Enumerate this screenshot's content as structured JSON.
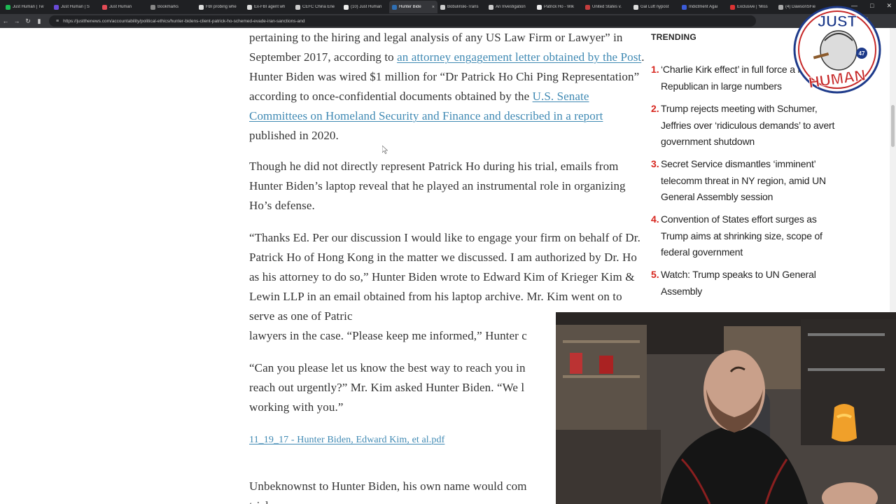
{
  "browser": {
    "tabs": [
      {
        "label": "Just Human | Tw",
        "color": "#1db954"
      },
      {
        "label": "Just Human | S",
        "color": "#6a4bd8"
      },
      {
        "label": "Just Human",
        "color": "#e34b55"
      },
      {
        "label": "Bookmarks",
        "color": "#888888"
      },
      {
        "label": "FBI probing whe",
        "color": "#dddddd"
      },
      {
        "label": "Ex-FBI agent wh",
        "color": "#dddddd"
      },
      {
        "label": "CEFC China Ene",
        "color": "#cccccc"
      },
      {
        "label": "(10) Just Human",
        "color": "#eeeeee"
      },
      {
        "label": "Hunter Bide",
        "color": "#2f6fb3"
      },
      {
        "label": "Bobulinski-Trans",
        "color": "#cccccc"
      },
      {
        "label": "An Investigation",
        "color": "#cccccc"
      },
      {
        "label": "Patrick Ho - Wik",
        "color": "#eeeeee"
      },
      {
        "label": "United States v.",
        "color": "#c43d3d"
      },
      {
        "label": "Gal Luft nypost",
        "color": "#dddddd"
      },
      {
        "label": "Indictment Agai",
        "color": "#3b5bd8"
      },
      {
        "label": "Exclusive | 'Miss",
        "color": "#d33"
      },
      {
        "label": "(4) DawsonSFie",
        "color": "#aaaaaa"
      }
    ],
    "active_tab_index": 8,
    "url": "https://justthenews.com/accountability/political-ethics/hunter-bidens-client-patrick-ho-schemed-evade-iran-sanctions-and"
  },
  "article": {
    "p1": {
      "t1": "pertaining to the hiring and legal analysis of any US Law Firm or Lawyer” in September 2017, according to ",
      "link1": "an attorney engagement letter obtained by the Post",
      "t2": ". Hunter Biden was wired $1 million for “Dr Patrick Ho Chi Ping Representation” according to once-confidential documents obtained by the ",
      "link2": "U.S. Senate Committees on Homeland Security and Finance and described in a report",
      "t3": " published in 2020."
    },
    "p2": "Though he did not directly represent Patrick Ho during his trial, emails from Hunter Biden’s laptop reveal that he played an instrumental role in organizing Ho’s defense.",
    "p3": "“Thanks Ed. Per our discussion I would like to engage your firm on behalf of Dr. Patrick Ho of Hong Kong in the matter we discussed. I am authorized by Dr. Ho as his attorney to do so,” Hunter Biden wrote to Edward Kim of Krieger Kim & Lewin LLP in an email obtained from his laptop archive. Mr. Kim went on to serve as one of Patric",
    "p3_tail": "lawyers in the case. “Please keep me informed,” Hunter c",
    "p4": "“Can you please let us know the best way to reach you in reach out urgently?” Mr. Kim asked Hunter Biden. “We l working with you.”",
    "p4_lines": [
      "“Can you please let us know the best way to reach you in",
      "reach out urgently?” Mr. Kim asked Hunter Biden. “We l",
      "working with you.”"
    ],
    "pdf_link": "11_19_17 - Hunter Biden, Edward Kim, et al.pdf",
    "p5_lines": [
      "Unbeknownst to Hunter Biden, his own name would com",
      "trial"
    ]
  },
  "trending": {
    "title": "TRENDING",
    "items": [
      {
        "num": "1.",
        "text": "‘Charlie Kirk effect’ in full force a register Republican in large numbers"
      },
      {
        "num": "2.",
        "text": "Trump rejects meeting with Schumer, Jeffries over ‘ridiculous demands’ to avert government shutdown"
      },
      {
        "num": "3.",
        "text": "Secret Service dismantles ‘imminent’ telecomm threat in NY region, amid UN General Assembly session"
      },
      {
        "num": "4.",
        "text": "Convention of States effort surges as Trump aims at shrinking size, scope of federal government"
      },
      {
        "num": "5.",
        "text": "Watch: Trump speaks to UN General Assembly"
      }
    ],
    "accent_color": "#d7261e"
  },
  "overlay": {
    "logo_line1": "JUST",
    "logo_line2": "HUMAN",
    "logo_badge": "47"
  },
  "colors": {
    "link": "#3f89b3",
    "body_text": "#333333",
    "chrome_bg": "#35363a"
  }
}
